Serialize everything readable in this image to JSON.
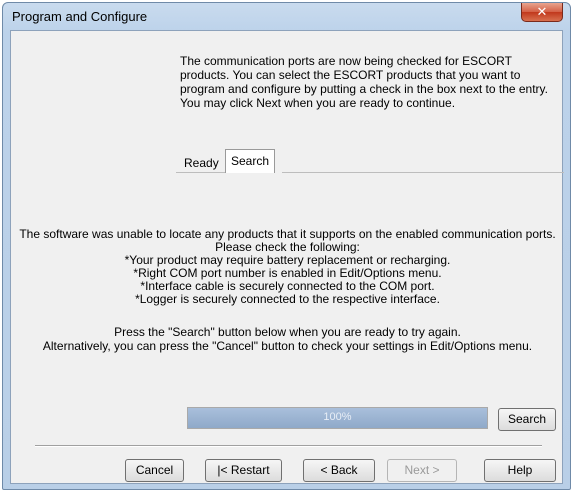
{
  "window": {
    "title": "Program and Configure",
    "close_glyph": "✕"
  },
  "instructions": "The communication ports are now being checked for ESCORT products. You can select the ESCORT products that you want to program and configure by putting a check in the box next to the entry. You may click Next when you are ready to continue.",
  "tabs": [
    {
      "label": "Ready"
    },
    {
      "label": "Search",
      "selected": true
    }
  ],
  "message": {
    "lines": [
      "The software was unable to locate any products that it supports on the enabled communication ports.",
      "Please check the following:",
      "*Your product may require battery replacement or recharging.",
      "*Right COM port number is enabled in Edit/Options menu.",
      "*Interface cable is securely connected to the COM port.",
      "*Logger is securely connected to the respective interface."
    ],
    "press_lines": [
      "Press the \"Search\" button below when you are ready to try again.",
      "Alternatively, you can press the \"Cancel\" button to check your settings in Edit/Options menu."
    ]
  },
  "progress": {
    "value": 1.0,
    "label": "100%"
  },
  "buttons": {
    "search": "Search",
    "cancel": "Cancel",
    "restart": "|< Restart",
    "back": "< Back",
    "next": "Next >",
    "help": "Help"
  }
}
